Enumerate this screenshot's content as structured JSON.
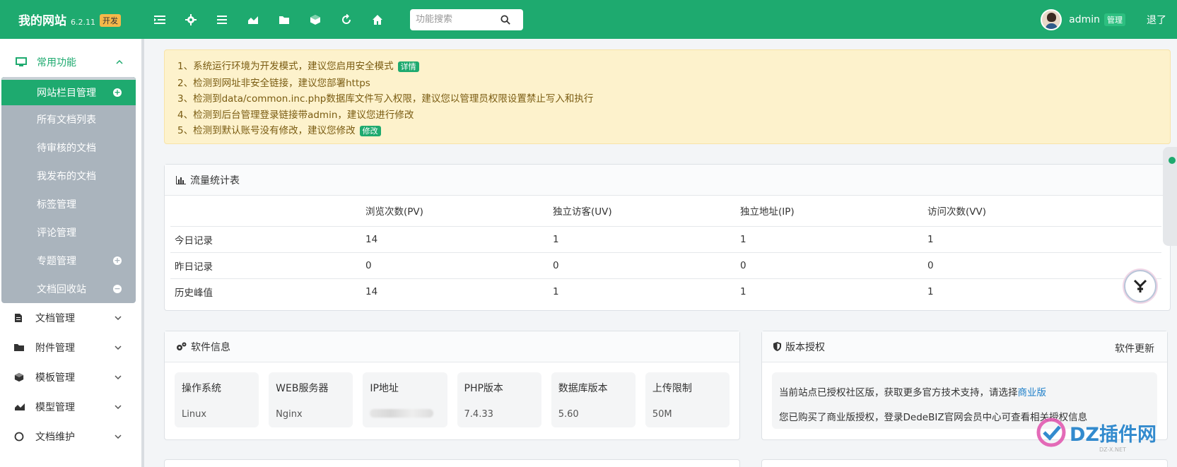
{
  "brand": {
    "name": "我的网站",
    "version": "6.2.11",
    "badge": "开发"
  },
  "toolbar": {
    "icons": [
      "list-icon",
      "gear-icon",
      "menu-icon",
      "chart-icon",
      "folder-icon",
      "cube-icon",
      "refresh-icon",
      "home-icon"
    ]
  },
  "search": {
    "placeholder": "功能搜索"
  },
  "user": {
    "name": "admin",
    "role": "管理",
    "logout": "退了"
  },
  "sidebar": {
    "group": {
      "label": "常用功能",
      "items": [
        {
          "label": "网站栏目管理",
          "active": true
        },
        {
          "label": "所有文档列表"
        },
        {
          "label": "待审核的文档"
        },
        {
          "label": "我发布的文档"
        },
        {
          "label": "标签管理"
        },
        {
          "label": "评论管理"
        },
        {
          "label": "专题管理"
        },
        {
          "label": "文档回收站"
        }
      ]
    },
    "items": [
      {
        "label": "文档管理"
      },
      {
        "label": "附件管理"
      },
      {
        "label": "模板管理"
      },
      {
        "label": "模型管理"
      },
      {
        "label": "文档维护"
      }
    ]
  },
  "alert": {
    "lines": [
      "1、系统运行环境为开发模式，建议您启用安全模式",
      "2、检测到网址非安全链接，建议您部署https",
      "3、检测到data/common.inc.php数据库文件写入权限，建议您以管理员权限设置禁止写入和执行",
      "4、检测到后台管理登录链接带admin，建议您进行修改",
      "5、检测到默认账号没有修改，建议您修改"
    ],
    "tag1": "详情",
    "tag5": "修改"
  },
  "traffic": {
    "title": "流量统计表",
    "columns": [
      "",
      "浏览次数(PV)",
      "独立访客(UV)",
      "独立地址(IP)",
      "访问次数(VV)"
    ],
    "rows": [
      [
        "今日记录",
        "14",
        "1",
        "1",
        "1"
      ],
      [
        "昨日记录",
        "0",
        "0",
        "0",
        "0"
      ],
      [
        "历史峰值",
        "14",
        "1",
        "1",
        "1"
      ]
    ]
  },
  "software": {
    "title": "软件信息",
    "items": [
      {
        "key": "操作系统",
        "value": "Linux"
      },
      {
        "key": "WEB服务器",
        "value": "Nginx"
      },
      {
        "key": "IP地址",
        "value": ""
      },
      {
        "key": "PHP版本",
        "value": "7.4.33"
      },
      {
        "key": "数据库版本",
        "value": "5.60"
      },
      {
        "key": "上传限制",
        "value": "50M"
      }
    ]
  },
  "license": {
    "title": "版本授权",
    "update": "软件更新",
    "line1": "当前站点已授权社区版，获取更多官方技术支持，请选择",
    "link": "商业版",
    "line2": "您已购买了商业版授权，登录DedeBIZ官网会员中心可查看相关授权信息"
  },
  "watermark": {
    "text": "DZ插件网",
    "sub": "DZ-X.NET"
  },
  "colors": {
    "primary": "#1eaa6f",
    "alert_bg": "#fdf2cc",
    "sidebar_sub": "#aab4bd"
  }
}
